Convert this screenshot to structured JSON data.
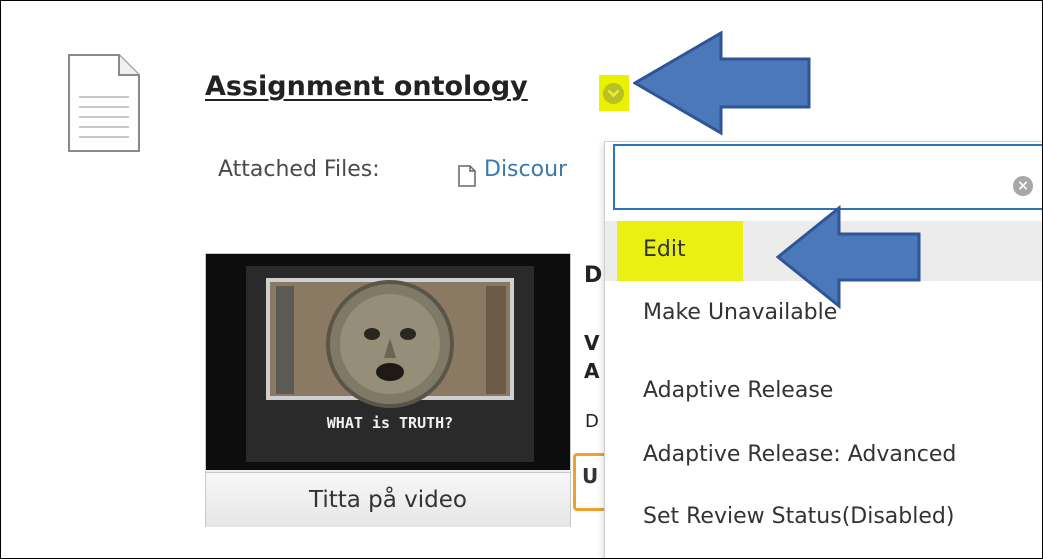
{
  "item": {
    "title": "Assignment ontology",
    "attached_label": "Attached Files:",
    "attached_file": "Discour"
  },
  "video": {
    "caption": "WHAT is TRUTH?",
    "button_label": "Titta på video"
  },
  "partial_text": {
    "heading_letter": "D",
    "line1": "V",
    "line2": "A",
    "line3": "D",
    "line4": "U"
  },
  "context_menu": {
    "search_value": "",
    "items": [
      {
        "label": "Edit"
      },
      {
        "label": "Make Unavailable"
      },
      {
        "label": "Adaptive Release"
      },
      {
        "label": "Adaptive Release: Advanced"
      },
      {
        "label": "Set Review Status(Disabled)"
      }
    ]
  },
  "colors": {
    "highlight_yellow": "#eaf011",
    "arrow_blue": "#4a78b8",
    "link_blue": "#3b79ad",
    "search_border": "#2c76b6"
  },
  "icons": {
    "document": "document-icon",
    "chevron": "chevron-down-icon",
    "file": "file-icon",
    "clear": "clear-search-icon",
    "annotation_arrow": "left-arrow-icon"
  }
}
